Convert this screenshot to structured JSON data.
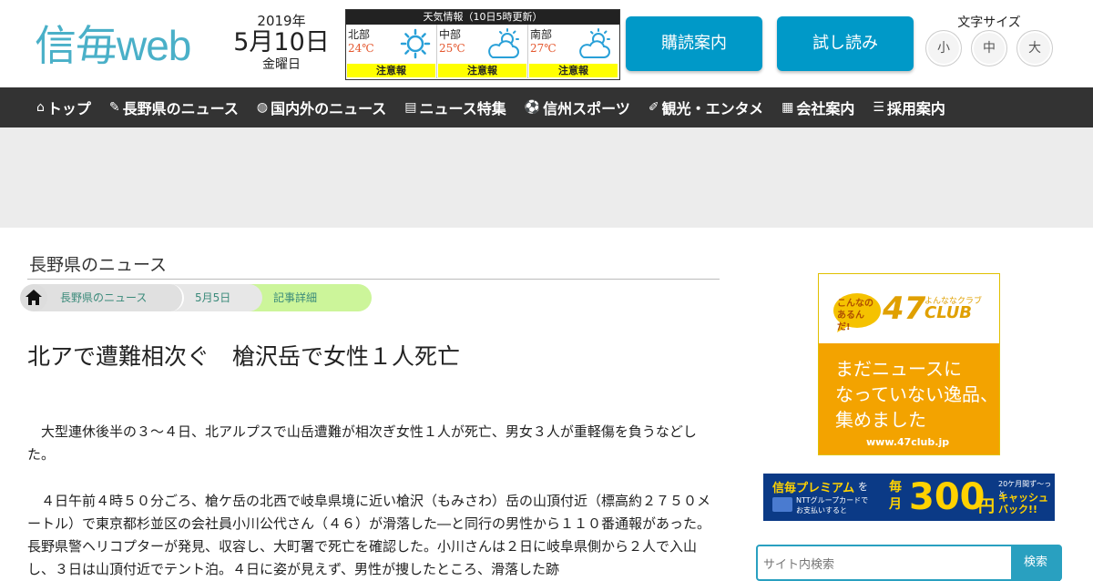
{
  "header": {
    "logo_main": "信毎",
    "logo_web": "web",
    "date_year": "2019年",
    "date_md": "5月10日",
    "date_dow": "金曜日",
    "weather_title": "天気情報（10日5時更新）",
    "weather": [
      {
        "region": "北部",
        "temp": "24℃",
        "icon": "sun-icon",
        "warning": "注意報"
      },
      {
        "region": "中部",
        "temp": "25℃",
        "icon": "partly-cloudy-icon",
        "warning": "注意報"
      },
      {
        "region": "南部",
        "temp": "27℃",
        "icon": "partly-cloudy-icon",
        "warning": "注意報"
      }
    ],
    "subscribe_label": "購読案内",
    "trial_label": "試し読み",
    "font_size_label": "文字サイズ",
    "font_small": "小",
    "font_medium": "中",
    "font_large": "大"
  },
  "nav": [
    {
      "label": "トップ",
      "icon": "home-icon"
    },
    {
      "label": "長野県のニュース",
      "icon": "pen-icon"
    },
    {
      "label": "国内外のニュース",
      "icon": "globe-icon"
    },
    {
      "label": "ニュース特集",
      "icon": "document-icon"
    },
    {
      "label": "信州スポーツ",
      "icon": "sports-icon"
    },
    {
      "label": "観光・エンタメ",
      "icon": "tag-icon"
    },
    {
      "label": "会社案内",
      "icon": "building-icon"
    },
    {
      "label": "採用案内",
      "icon": "list-icon"
    }
  ],
  "section_title": "長野県のニュース",
  "breadcrumb": [
    "長野県のニュース",
    "5月5日",
    "記事詳細"
  ],
  "article": {
    "headline": "北アで遭難相次ぐ　槍沢岳で女性１人死亡",
    "p1": "　大型連休後半の３〜４日、北アルプスで山岳遭難が相次ぎ女性１人が死亡、男女３人が重軽傷を負うなどした。",
    "p2": "　４日午前４時５０分ごろ、槍ケ岳の北西で岐阜県境に近い槍沢（もみさわ）岳の山頂付近（標高約２７５０メートル）で東京都杉並区の会社員小川公代さん（４６）が滑落した―と同行の男性から１１０番通報があった。長野県警ヘリコプターが発見、収容し、大町署で死亡を確認した。小川さんは２日に岐阜県側から２人で入山し、３日は山頂付近でテント泊。４日に姿が見えず、男性が捜したところ、滑落した跡"
  },
  "ad47": {
    "top_small": "こんなの あるんだ!",
    "brand": "47",
    "brand_sub": "よんななクラブ",
    "brand_club": "CLUB",
    "line1": "まだニュースに",
    "line2": "なっていない逸品、",
    "line3": "集めました",
    "url": "www.47club.jp"
  },
  "premium": {
    "brand": "信毎プレミアム",
    "brand_suffix": "を",
    "sub1": "NTTグループカードで",
    "sub2": "お支払いすると",
    "monthly": "毎月",
    "amount": "300",
    "unit": "円",
    "months": "20ケ月間ず〜っと",
    "cashback": "キャッシュバック!!"
  },
  "search": {
    "placeholder": "サイト内検索",
    "button_label": "検索"
  }
}
